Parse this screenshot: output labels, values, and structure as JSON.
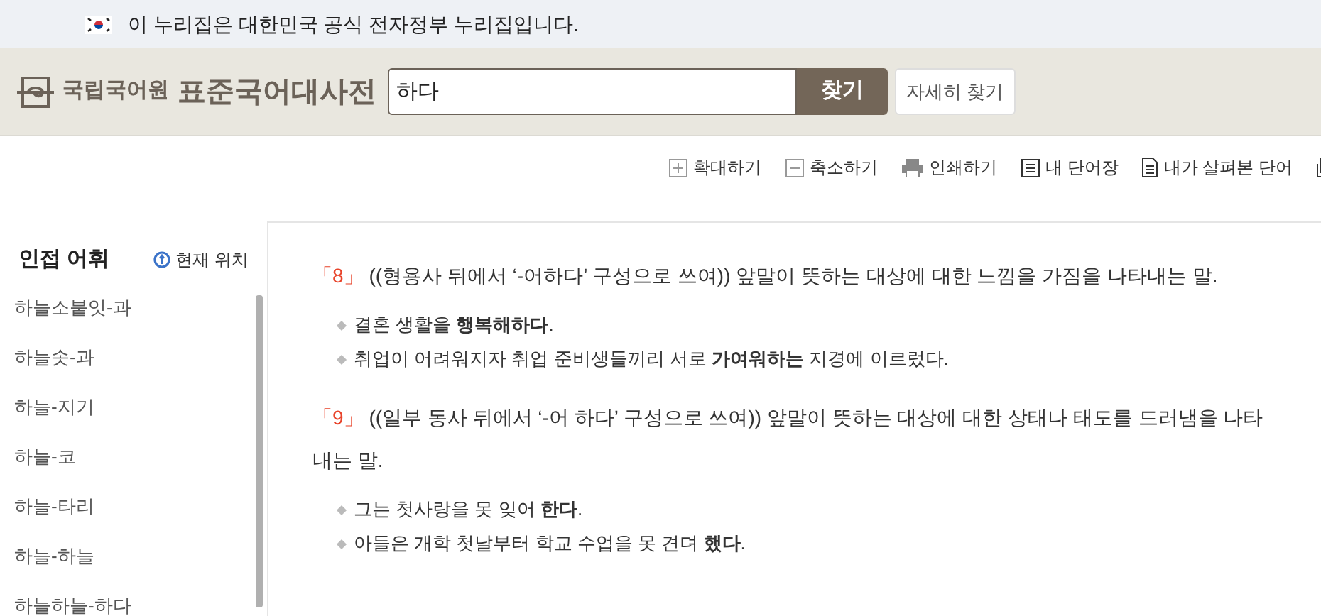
{
  "gov_banner": {
    "text": "이 누리집은 대한민국 공식 전자정부 누리집입니다."
  },
  "header": {
    "org": "국립국어원",
    "title": "표준국어대사전",
    "search": {
      "value": "하다"
    },
    "search_button": "찾기",
    "advanced_button": "자세히 찾기"
  },
  "toolbar": [
    {
      "kind": "zoom-in",
      "label": "확대하기"
    },
    {
      "kind": "zoom-out",
      "label": "축소하기"
    },
    {
      "kind": "print",
      "label": "인쇄하기"
    },
    {
      "kind": "list",
      "label": "내 단어장"
    },
    {
      "kind": "doc",
      "label": "내가 살펴본 단어"
    },
    {
      "kind": "copy"
    }
  ],
  "sidebar": {
    "title": "인접 어휘",
    "current_link": "현재 위치",
    "items": [
      {
        "label": "하늘소붙잇-과"
      },
      {
        "label": "하늘솟-과"
      },
      {
        "label": "하늘-지기"
      },
      {
        "label": "하늘-코"
      },
      {
        "label": "하늘-타리"
      },
      {
        "label": "하늘-하늘"
      },
      {
        "label": "하늘하늘-하다"
      }
    ]
  },
  "senses": [
    {
      "number": "「8」",
      "definition": "((형용사 뒤에서 ‘-어하다’ 구성으로 쓰여)) 앞말이 뜻하는 대상에 대한 느낌을 가짐을 나타내는 말.",
      "examples": [
        "결혼 생활을 **행복해하다**.",
        "취업이 어려워지자 취업 준비생들끼리 서로 **가여워하는** 지경에 이르렀다."
      ]
    },
    {
      "number": "「9」",
      "definition": "((일부 동사 뒤에서 ‘-어 하다’ 구성으로 쓰여)) 앞말이 뜻하는 대상에 대한 상태나 태도를 드러냄을 나타내는 말.",
      "examples": [
        "그는 첫사랑을 못 잊어 **한다**.",
        "아들은 개학 첫날부터 학교 수업을 못 견뎌 **했다**."
      ]
    }
  ]
}
